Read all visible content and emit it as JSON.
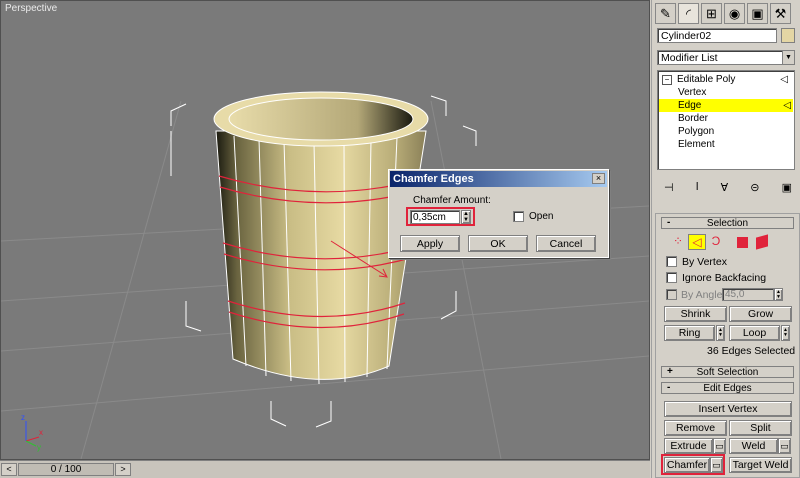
{
  "viewport": {
    "label": "Perspective"
  },
  "timeline": {
    "frame_display": "0 / 100",
    "prev": "<",
    "next": ">"
  },
  "panel": {
    "object_name": "Cylinder02",
    "object_color": "#e4d6a4",
    "modifier_list": "Modifier List",
    "stack": [
      {
        "label": "Editable Poly",
        "selected": false
      },
      {
        "label": "Vertex",
        "selected": false
      },
      {
        "label": "Edge",
        "selected": true
      },
      {
        "label": "Border",
        "selected": false
      },
      {
        "label": "Polygon",
        "selected": false
      },
      {
        "label": "Element",
        "selected": false
      }
    ],
    "selection": {
      "title": "Selection",
      "by_vertex": "By Vertex",
      "ignore_backfacing": "Ignore Backfacing",
      "by_angle": "By Angle:",
      "angle_value": "45,0",
      "shrink": "Shrink",
      "grow": "Grow",
      "ring": "Ring",
      "loop": "Loop",
      "status": "36 Edges Selected"
    },
    "soft_selection": {
      "title": "Soft Selection",
      "sign": "+"
    },
    "edit_edges": {
      "title": "Edit Edges",
      "sign": "-",
      "insert_vertex": "Insert Vertex",
      "remove": "Remove",
      "split": "Split",
      "extrude": "Extrude",
      "weld": "Weld",
      "chamfer": "Chamfer",
      "target_weld": "Target Weld"
    }
  },
  "dialog": {
    "title": "Chamfer Edges",
    "close": "×",
    "amount_label": "Chamfer Amount:",
    "amount_value": "0,35cm",
    "open_label": "Open",
    "apply": "Apply",
    "ok": "OK",
    "cancel": "Cancel"
  },
  "colors": {
    "accent_red": "#e0233b",
    "selected_yellow": "#ffff00",
    "viewport_bg": "#7a7a7a"
  }
}
